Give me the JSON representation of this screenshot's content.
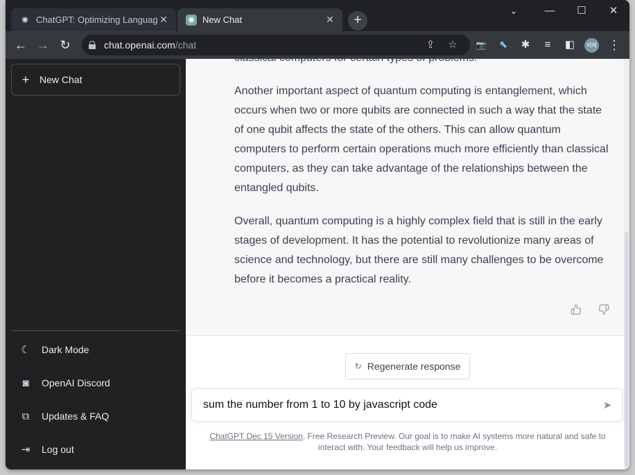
{
  "browser": {
    "tabs": [
      {
        "title": "ChatGPT: Optimizing Language",
        "icon": "openai-logo-icon",
        "active": false
      },
      {
        "title": "New Chat",
        "icon": "chatgpt-favicon-icon",
        "active": true
      }
    ],
    "close_glyph": "✕",
    "new_tab_glyph": "+",
    "window_controls": {
      "tab_search": "⌄",
      "minimize": "—",
      "maximize": "☐",
      "close": "✕"
    },
    "nav": {
      "back": "←",
      "forward": "→",
      "reload": "↻"
    },
    "url": {
      "host": "chat.openai.com",
      "path": "/chat"
    },
    "omnibox_icons": {
      "share": "⇪",
      "bookmark": "☆"
    },
    "extensions": {
      "camera": "📷",
      "cursor": "⬉",
      "puzzle": "✱",
      "media": "≡",
      "sidepanel": "◧",
      "menu": "⋮"
    },
    "profile_initials": "페페"
  },
  "sidebar": {
    "new_chat": {
      "icon": "+",
      "label": "New Chat"
    },
    "items": [
      {
        "icon": "☾",
        "label": "Dark Mode"
      },
      {
        "icon": "◙",
        "label": "OpenAI Discord"
      },
      {
        "icon": "⧉",
        "label": "Updates & FAQ"
      },
      {
        "icon": "⇥",
        "label": "Log out"
      }
    ]
  },
  "conversation": {
    "paragraphs": [
      "classical computers for certain types of problems.",
      "Another important aspect of quantum computing is entanglement, which occurs when two or more qubits are connected in such a way that the state of one qubit affects the state of the others. This can allow quantum computers to perform certain operations much more efficiently than classical computers, as they can take advantage of the relationships between the entangled qubits.",
      "Overall, quantum computing is a highly complex field that is still in the early stages of development. It has the potential to revolutionize many areas of science and technology, but there are still many challenges to be overcome before it becomes a practical reality."
    ],
    "feedback": {
      "thumbs_up": "👍",
      "thumbs_down": "👎"
    }
  },
  "composer": {
    "regenerate": {
      "icon": "↻",
      "label": "Regenerate response"
    },
    "input_value": "sum the number from 1 to 10 by javascript code",
    "send_icon": "➤"
  },
  "footer": {
    "link": "ChatGPT Dec 15 Version",
    "text": ". Free Research Preview. Our goal is to make AI systems more natural and safe to interact with. Your feedback will help us improve."
  }
}
